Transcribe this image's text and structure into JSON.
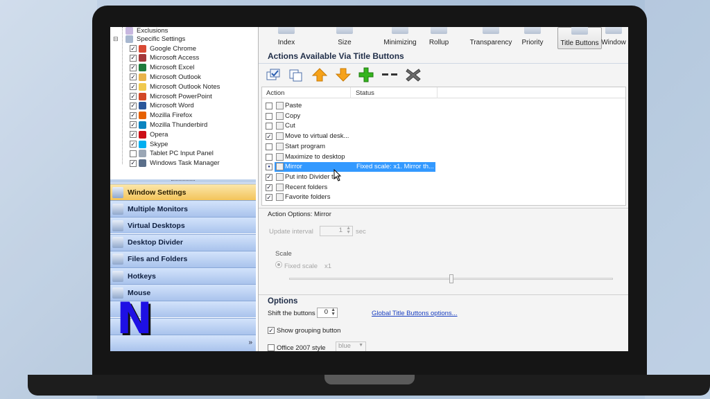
{
  "tree": {
    "top_items": [
      "Exclusions",
      "Specific Settings"
    ],
    "apps": [
      {
        "label": "Google Chrome",
        "checked": true,
        "icon": "chrome-icon",
        "color": "#d94a35"
      },
      {
        "label": "Microsoft Access",
        "checked": true,
        "icon": "access-icon",
        "color": "#a4373a"
      },
      {
        "label": "Microsoft Excel",
        "checked": true,
        "icon": "excel-icon",
        "color": "#1f7a3c"
      },
      {
        "label": "Microsoft Outlook",
        "checked": true,
        "icon": "outlook-icon",
        "color": "#e8b34a"
      },
      {
        "label": "Microsoft Outlook Notes",
        "checked": true,
        "icon": "outlook-notes-icon",
        "color": "#f0c94e"
      },
      {
        "label": "Microsoft PowerPoint",
        "checked": true,
        "icon": "powerpoint-icon",
        "color": "#d24726"
      },
      {
        "label": "Microsoft Word",
        "checked": true,
        "icon": "word-icon",
        "color": "#2b579a"
      },
      {
        "label": "Mozilla Firefox",
        "checked": true,
        "icon": "firefox-icon",
        "color": "#e66000"
      },
      {
        "label": "Mozilla Thunderbird",
        "checked": true,
        "icon": "thunderbird-icon",
        "color": "#0a84c0"
      },
      {
        "label": "Opera",
        "checked": true,
        "icon": "opera-icon",
        "color": "#cc0f16"
      },
      {
        "label": "Skype",
        "checked": true,
        "icon": "skype-icon",
        "color": "#00aff0"
      },
      {
        "label": "Tablet PC Input Panel",
        "checked": false,
        "icon": "tablet-icon",
        "color": "#9aa6b5"
      },
      {
        "label": "Windows Task Manager",
        "checked": true,
        "icon": "task-manager-icon",
        "color": "#5b6f8a"
      }
    ]
  },
  "nav": {
    "items": [
      "Window Settings",
      "Multiple Monitors",
      "Virtual Desktops",
      "Desktop Divider",
      "Files and Folders",
      "Hotkeys",
      "Mouse"
    ],
    "active": "Window Settings",
    "logo_letter": "N",
    "more_glyph": "»"
  },
  "toolbar": {
    "items": [
      "Index",
      "Size",
      "Minimizing",
      "Rollup",
      "Transparency",
      "Priority",
      "Title Buttons",
      "Window"
    ],
    "selected": "Title Buttons"
  },
  "actions_section": {
    "title": "Actions Available Via Title Buttons",
    "buttons": [
      "check-all-icon",
      "copy-icon",
      "move-up-icon",
      "move-down-icon",
      "add-icon",
      "remove-icon",
      "delete-icon"
    ],
    "columns": {
      "action": "Action",
      "status": "Status"
    },
    "rows": [
      {
        "label": "Paste",
        "checked": false,
        "status": ""
      },
      {
        "label": "Copy",
        "checked": false,
        "status": ""
      },
      {
        "label": "Cut",
        "checked": false,
        "status": ""
      },
      {
        "label": "Move to virtual desk...",
        "checked": true,
        "status": ""
      },
      {
        "label": "Start program",
        "checked": false,
        "status": ""
      },
      {
        "label": "Maximize to desktop",
        "checked": false,
        "status": ""
      },
      {
        "label": "Mirror",
        "checked": true,
        "status": "Fixed scale: x1. Mirror th...",
        "selected": true
      },
      {
        "label": "Put into Divider tile",
        "checked": true,
        "status": ""
      },
      {
        "label": "Recent folders",
        "checked": true,
        "status": ""
      },
      {
        "label": "Favorite folders",
        "checked": true,
        "status": ""
      }
    ]
  },
  "action_options": {
    "title": "Action Options: Mirror",
    "update_interval_label": "Update interval",
    "update_interval_value": "1",
    "update_interval_unit": "sec",
    "scale_label": "Scale",
    "fixed_scale_label": "Fixed scale",
    "fixed_scale_value": "x1",
    "slider_position": 0.5
  },
  "options": {
    "title": "Options",
    "shift_label": "Shift the buttons",
    "shift_value": "0",
    "global_link": "Global Title Buttons options...",
    "grouping_label": "Show grouping button",
    "grouping_checked": true,
    "office_label": "Office 2007 style",
    "office_checked": false,
    "style_value": "blue"
  },
  "colors": {
    "accent_selection": "#3399ff",
    "nav_active": "#f3c45a",
    "nav_default": "#a9c3ec",
    "logo": "#1e10e4"
  }
}
